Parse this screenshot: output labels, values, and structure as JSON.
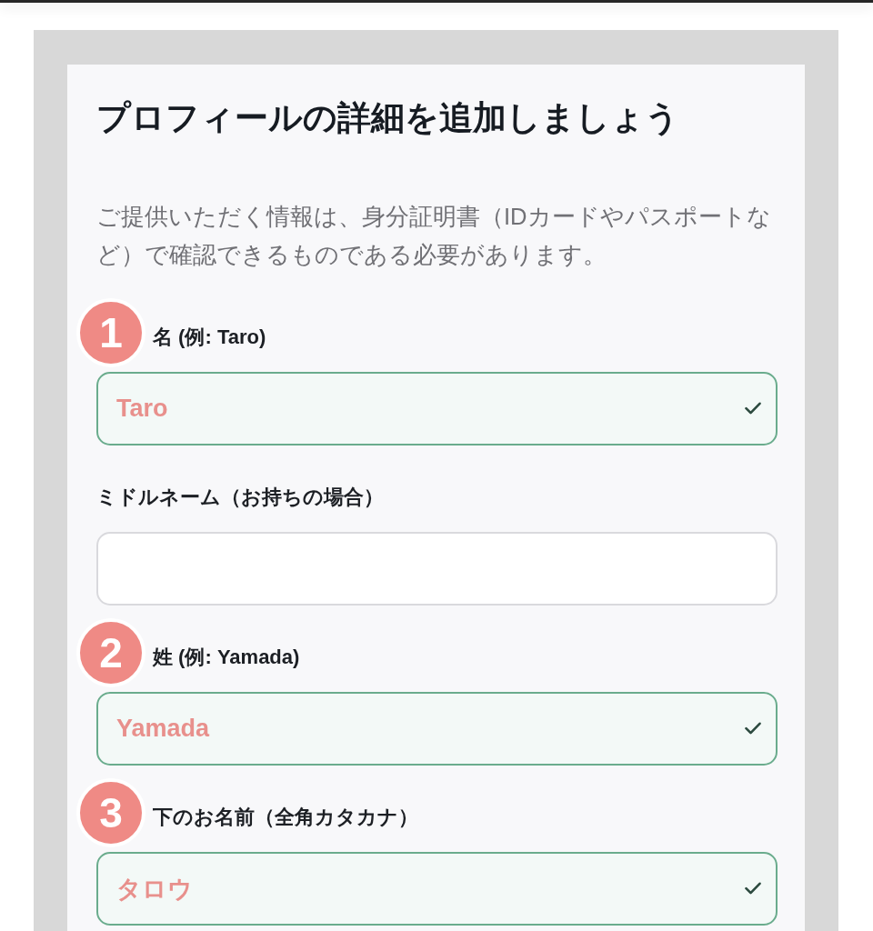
{
  "heading": {
    "title": "プロフィールの詳細を追加しましょう",
    "description": "ご提供いただく情報は、身分証明書（IDカードやパスポートなど）で確認できるものである必要があります。"
  },
  "fields": [
    {
      "step": "1",
      "label": "名 (例: Taro)",
      "value": "Taro",
      "valid": true
    },
    {
      "label": "ミドルネーム（お持ちの場合）",
      "valid": false
    },
    {
      "step": "2",
      "label": "姓 (例: Yamada)",
      "value": "Yamada",
      "valid": true
    },
    {
      "step": "3",
      "label": "下のお名前（全角カタカナ）",
      "value": "タロウ",
      "valid": true
    }
  ]
}
